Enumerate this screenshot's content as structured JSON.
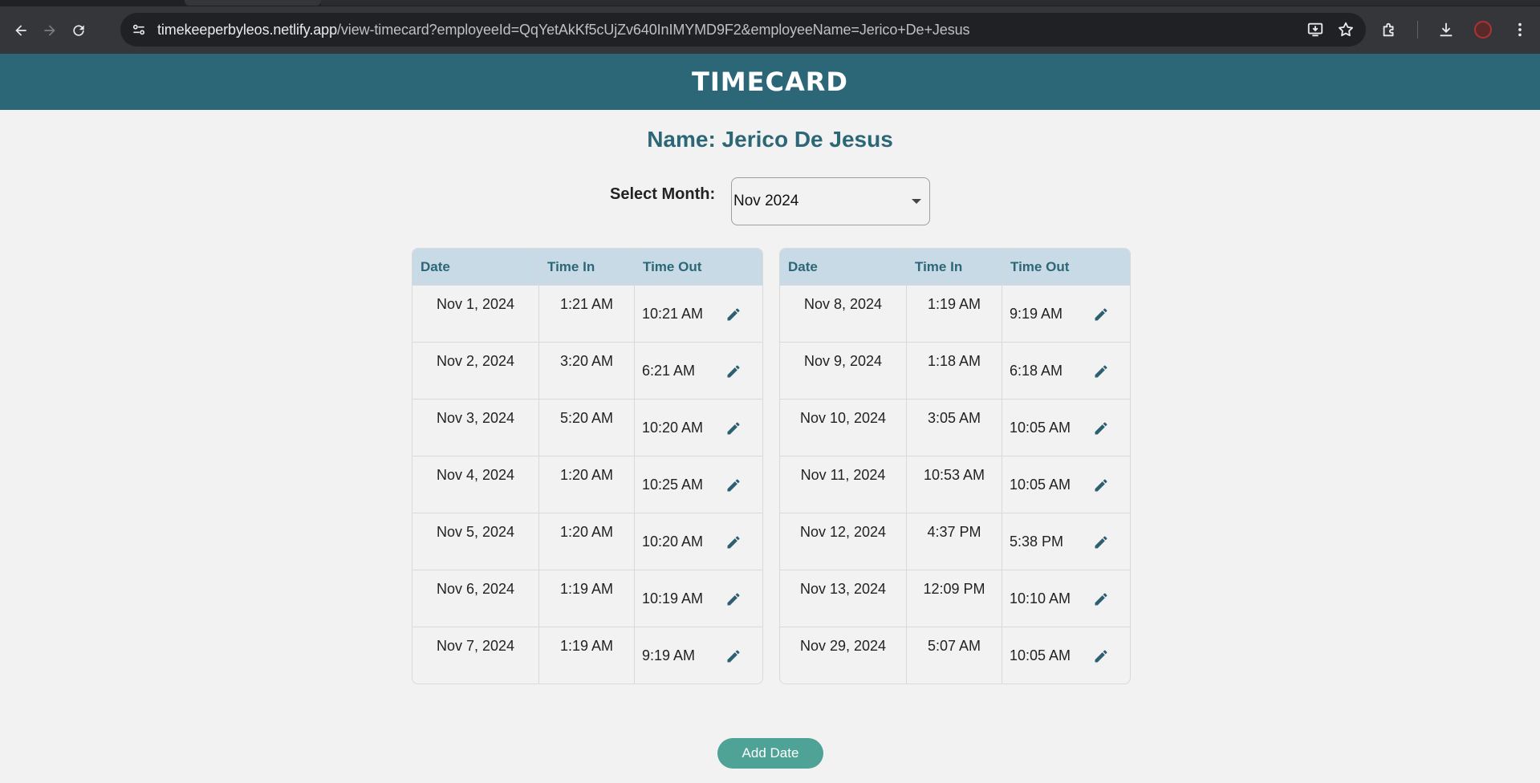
{
  "browser": {
    "url_host": "timekeeperbyleos.netlify.app",
    "url_path": "/view-timecard?employeeId=QqYetAkKf5cUjZv640InIMYMD9F2&employeeName=Jerico+De+Jesus"
  },
  "app": {
    "title": "TIMECARD",
    "name_line": "Name: Jerico De Jesus",
    "select_month_label": "Select Month:",
    "selected_month": "Nov 2024",
    "add_button": "Add Date"
  },
  "table_headers": {
    "date": "Date",
    "time_in": "Time In",
    "time_out": "Time Out"
  },
  "left_rows": [
    {
      "date": "Nov 1, 2024",
      "in": "1:21 AM",
      "out": "10:21 AM"
    },
    {
      "date": "Nov 2, 2024",
      "in": "3:20 AM",
      "out": "6:21 AM"
    },
    {
      "date": "Nov 3, 2024",
      "in": "5:20 AM",
      "out": "10:20 AM"
    },
    {
      "date": "Nov 4, 2024",
      "in": "1:20 AM",
      "out": "10:25 AM"
    },
    {
      "date": "Nov 5, 2024",
      "in": "1:20 AM",
      "out": "10:20 AM"
    },
    {
      "date": "Nov 6, 2024",
      "in": "1:19 AM",
      "out": "10:19 AM"
    },
    {
      "date": "Nov 7, 2024",
      "in": "1:19 AM",
      "out": "9:19 AM"
    }
  ],
  "right_rows": [
    {
      "date": "Nov 8, 2024",
      "in": "1:19 AM",
      "out": "9:19 AM"
    },
    {
      "date": "Nov 9, 2024",
      "in": "1:18 AM",
      "out": "6:18 AM"
    },
    {
      "date": "Nov 10, 2024",
      "in": "3:05 AM",
      "out": "10:05 AM"
    },
    {
      "date": "Nov 11, 2024",
      "in": "10:53 AM",
      "out": "10:05 AM"
    },
    {
      "date": "Nov 12, 2024",
      "in": "4:37 PM",
      "out": "5:38 PM"
    },
    {
      "date": "Nov 13, 2024",
      "in": "12:09 PM",
      "out": "10:10 AM"
    },
    {
      "date": "Nov 29, 2024",
      "in": "5:07 AM",
      "out": "10:05 AM"
    }
  ],
  "colors": {
    "header_bg": "#2c6778",
    "table_header_bg": "#c8dae6",
    "accent_text": "#2c6778",
    "add_button_bg": "#4fa396"
  }
}
